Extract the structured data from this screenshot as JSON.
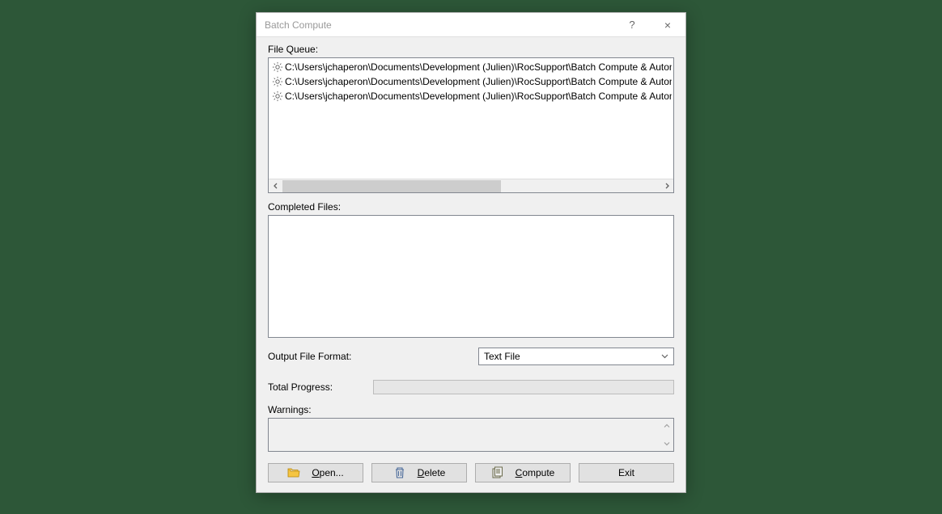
{
  "titlebar": {
    "title": "Batch Compute",
    "help": "?",
    "close": "×"
  },
  "fileQueue": {
    "label": "File Queue:",
    "items": [
      "C:\\Users\\jchaperon\\Documents\\Development (Julien)\\RocSupport\\Batch Compute & Automate Co",
      "C:\\Users\\jchaperon\\Documents\\Development (Julien)\\RocSupport\\Batch Compute & Automate Co",
      "C:\\Users\\jchaperon\\Documents\\Development (Julien)\\RocSupport\\Batch Compute & Automate Co"
    ]
  },
  "completedFiles": {
    "label": "Completed Files:"
  },
  "outputFormat": {
    "label": "Output File Format:",
    "value": "Text File"
  },
  "totalProgress": {
    "label": "Total Progress:"
  },
  "warnings": {
    "label": "Warnings:"
  },
  "buttons": {
    "open": "Open...",
    "delete": "Delete",
    "compute": "Compute",
    "exit": "Exit"
  }
}
